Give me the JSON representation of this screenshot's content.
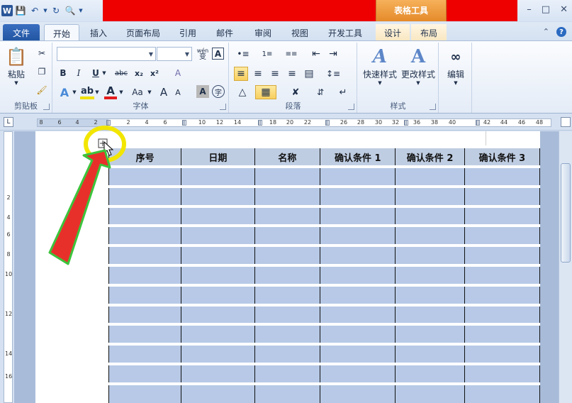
{
  "title_bar": {
    "app_icon_letter": "W",
    "context_tab_label": "表格工具",
    "window_controls": [
      "–",
      "□",
      "✕"
    ]
  },
  "tabs": [
    {
      "label": "文件"
    },
    {
      "label": "开始"
    },
    {
      "label": "插入"
    },
    {
      "label": "页面布局"
    },
    {
      "label": "引用"
    },
    {
      "label": "邮件"
    },
    {
      "label": "审阅"
    },
    {
      "label": "视图"
    },
    {
      "label": "开发工具"
    },
    {
      "label": "设计"
    },
    {
      "label": "布局"
    }
  ],
  "active_tab": "开始",
  "ribbon": {
    "clipboard": {
      "label": "剪贴板",
      "paste": "粘贴"
    },
    "font": {
      "label": "字体",
      "font_name": "",
      "font_size": "",
      "wen_glyph": "wén",
      "wen_char": "变",
      "bold": "B",
      "italic": "I",
      "underline": "U",
      "strike": "abc",
      "sub": "x₂",
      "sup": "x²",
      "clear": "A",
      "text_a": "A",
      "case": "Aa",
      "grow": "A",
      "shrink": "A",
      "charshade": "A",
      "enclose": "字"
    },
    "paragraph": {
      "label": "段落"
    },
    "styles": {
      "label": "样式",
      "quick_styles": "快速样式",
      "change_styles": "更改样式"
    },
    "editing": {
      "label": "编辑",
      "edit": "编辑"
    }
  },
  "ruler": {
    "ticks": [
      "8",
      "6",
      "4",
      "2",
      "2",
      "4",
      "6",
      "10",
      "12",
      "14",
      "18",
      "20",
      "22",
      "26",
      "28",
      "30",
      "32",
      "36",
      "38",
      "40",
      "42",
      "44",
      "46",
      "48"
    ]
  },
  "vruler": {
    "ticks": [
      "2",
      "4",
      "6",
      "8",
      "10",
      "12",
      "14",
      "16"
    ]
  },
  "table": {
    "headers": [
      "序号",
      "日期",
      "名称",
      "确认条件 1",
      "确认条件 2",
      "确认条件 3"
    ],
    "row_count": 12
  },
  "annotation": {
    "highlight_color": "#f2e600",
    "arrow_color": "#e8302a",
    "arrow_outline": "#3cc43c"
  },
  "colors": {
    "header_fill": "#bfcde2",
    "row_fill": "#b7c9e6",
    "accent_red": "#ee0000",
    "context_tab": "#e58a2a"
  }
}
